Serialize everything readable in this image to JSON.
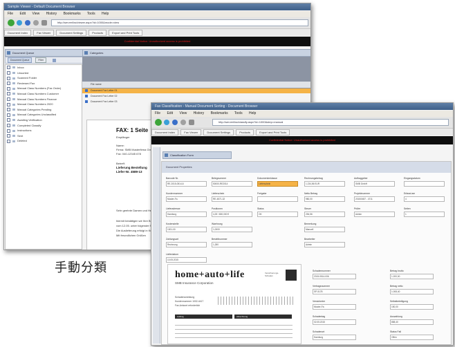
{
  "caption": "手動分類",
  "back_window": {
    "title": "Sample Viewer - Default Document Browser",
    "menu": [
      "File",
      "Edit",
      "View",
      "History",
      "Bookmarks",
      "Tools",
      "Help"
    ],
    "url": "http://server/fax/viewer.aspx?id=1000&mode=view",
    "tabs": [
      "Document Index",
      "Fax Viewer",
      "Document Settings",
      "Products",
      "Export and Print Tools"
    ],
    "red_banner": "Confidential Notice: Unauthorized access is prohibited",
    "left_panel_title": "Document Queue",
    "left_toolbar": [
      "Document Queue",
      "Filter"
    ],
    "tree": [
      "Inbox",
      "Unsorted",
      "Scanned Folder",
      "Reviewed Fax",
      "Manual Class Numbers (Fax Order)",
      "Manual Class Numbers Customer",
      "Manual Class Numbers Finance",
      "Manual Class Numbers 2020",
      "Manual Categories Pending",
      "Manual Categories Unclassified",
      "Awaiting Verification",
      "Completed Classify",
      "Instructions",
      "Sent",
      "Deleted"
    ],
    "right_panel_title": "Categories",
    "list_header": "File name",
    "list_rows": [
      "Document Fax Letter 01",
      "Document Fax Letter 02",
      "Document Fax Letter 03"
    ],
    "fax": {
      "heading": "FAX: 1 Seite",
      "line1": "Empfänger",
      "fields": [
        "Name:",
        "Firma:",
        "Fax:"
      ],
      "values": [
        "",
        "SMB Musterfirma GmbH",
        "040-12345 678"
      ],
      "ref_label": "Betreff:",
      "ref_line1": "Lieferung Bestellung",
      "ref_line2": "Liefer-Nr. 4589-13",
      "greeting": "Sehr geehrte Damen und Herren,",
      "body": [
        "hiermit bestätigen wir Ihre Bestellung",
        "vom 12.05. unter folgender Nummer.",
        "Die Auslieferung erfolgt in Kürze.",
        "Mit freundlichen Grüßen"
      ]
    }
  },
  "front_window": {
    "title": "Fax Classification - Manual Document Sorting - Document Browser",
    "menu": [
      "File",
      "Edit",
      "View",
      "History",
      "Bookmarks",
      "Tools",
      "Help"
    ],
    "url": "http://server/fax/classify.aspx?id=1000&step=manual",
    "tabs": [
      "Document Index",
      "Fax Viewer",
      "Document Settings",
      "Products",
      "Export and Print Tools"
    ],
    "red_banner": "Confidential Notice: Unauthorized access is prohibited",
    "panel_title": "Classification Form",
    "band_title": "Document Properties",
    "form_columns": [
      [
        {
          "label": "Barcode Nr.",
          "value": "RE-2015-0514-6"
        },
        {
          "label": "Kundennummer",
          "value": "Muster-Fa"
        },
        {
          "label": "Lieferadresse",
          "value": "Hamburg"
        },
        {
          "label": "Kostenstelle",
          "value": "1001-00"
        },
        {
          "label": "Zahlungsart",
          "value": "Rechnung"
        },
        {
          "label": "Lieferdatum",
          "value": "10.05.2015"
        }
      ],
      [
        {
          "label": "Belegnummer",
          "value": "50000-RE2014"
        },
        {
          "label": "Lieferschein",
          "value": "RE-4571-32"
        },
        {
          "label": "Positionen",
          "value": "4,25 / 800,000 €"
        },
        {
          "label": "Waehrung",
          "value": "1,0000"
        },
        {
          "label": "Bestellnummer",
          "value": "1,280"
        }
      ],
      [
        {
          "label": "Dokumentenklasse",
          "value": "Lieferschein"
        },
        {
          "label": "Freigabe",
          "value": ""
        },
        {
          "label": "Status",
          "value": "OK"
        }
      ],
      [
        {
          "label": "Rechnungsbetrag",
          "value": "1.234,56 EUR"
        },
        {
          "label": "Netto Betrag",
          "value": "980,00"
        },
        {
          "label": "Steuer",
          "value": "254,56"
        },
        {
          "label": "Bemerkung",
          "value": "Manuell"
        },
        {
          "label": "Bearbeiter",
          "value": "Admin"
        }
      ],
      [
        {
          "label": "Auftraggeber",
          "value": "SMB GmbH"
        },
        {
          "label": "Projektnummer",
          "value": "2015/0457 - 4711"
        },
        {
          "label": "Prüfer",
          "value": "Admin"
        }
      ],
      [
        {
          "label": "Eingangsdatum",
          "value": ""
        },
        {
          "label": "Erfasst am",
          "value": "4"
        },
        {
          "label": "Seiten",
          "value": "1"
        }
      ]
    ],
    "doc_logo_line1": "home+auto+life",
    "doc_logo_line2": "SMB Insurance Corporation",
    "doc_side_text": "Versicherungs-Schaden",
    "doc_lines": [
      "Schadensmeldung",
      "Kundennummer 1002-4417",
      "Fax-Antwort erforderlich"
    ],
    "doc_tabs": [
      "Auftrag",
      "Abrechnung"
    ],
    "doc_fields_mid": [
      {
        "label": "Schadennummer",
        "value": "2015-0514-006"
      },
      {
        "label": "Vertragsnummer",
        "value": "SP-5178"
      },
      {
        "label": "Versicherter",
        "value": "Muster-Fa"
      },
      {
        "label": "Schadentag",
        "value": "02.05.2015"
      },
      {
        "label": "Schadenort",
        "value": "Hamburg"
      }
    ],
    "doc_fields_right": [
      {
        "label": "Betrag brutto",
        "value": "1.200,00"
      },
      {
        "label": "Betrag netto",
        "value": "1.008,40"
      },
      {
        "label": "Selbstbeteiligung",
        "value": "150,00"
      },
      {
        "label": "Auszahlung",
        "value": "858,40"
      },
      {
        "label": "Status Fall",
        "value": "Offen"
      }
    ]
  }
}
